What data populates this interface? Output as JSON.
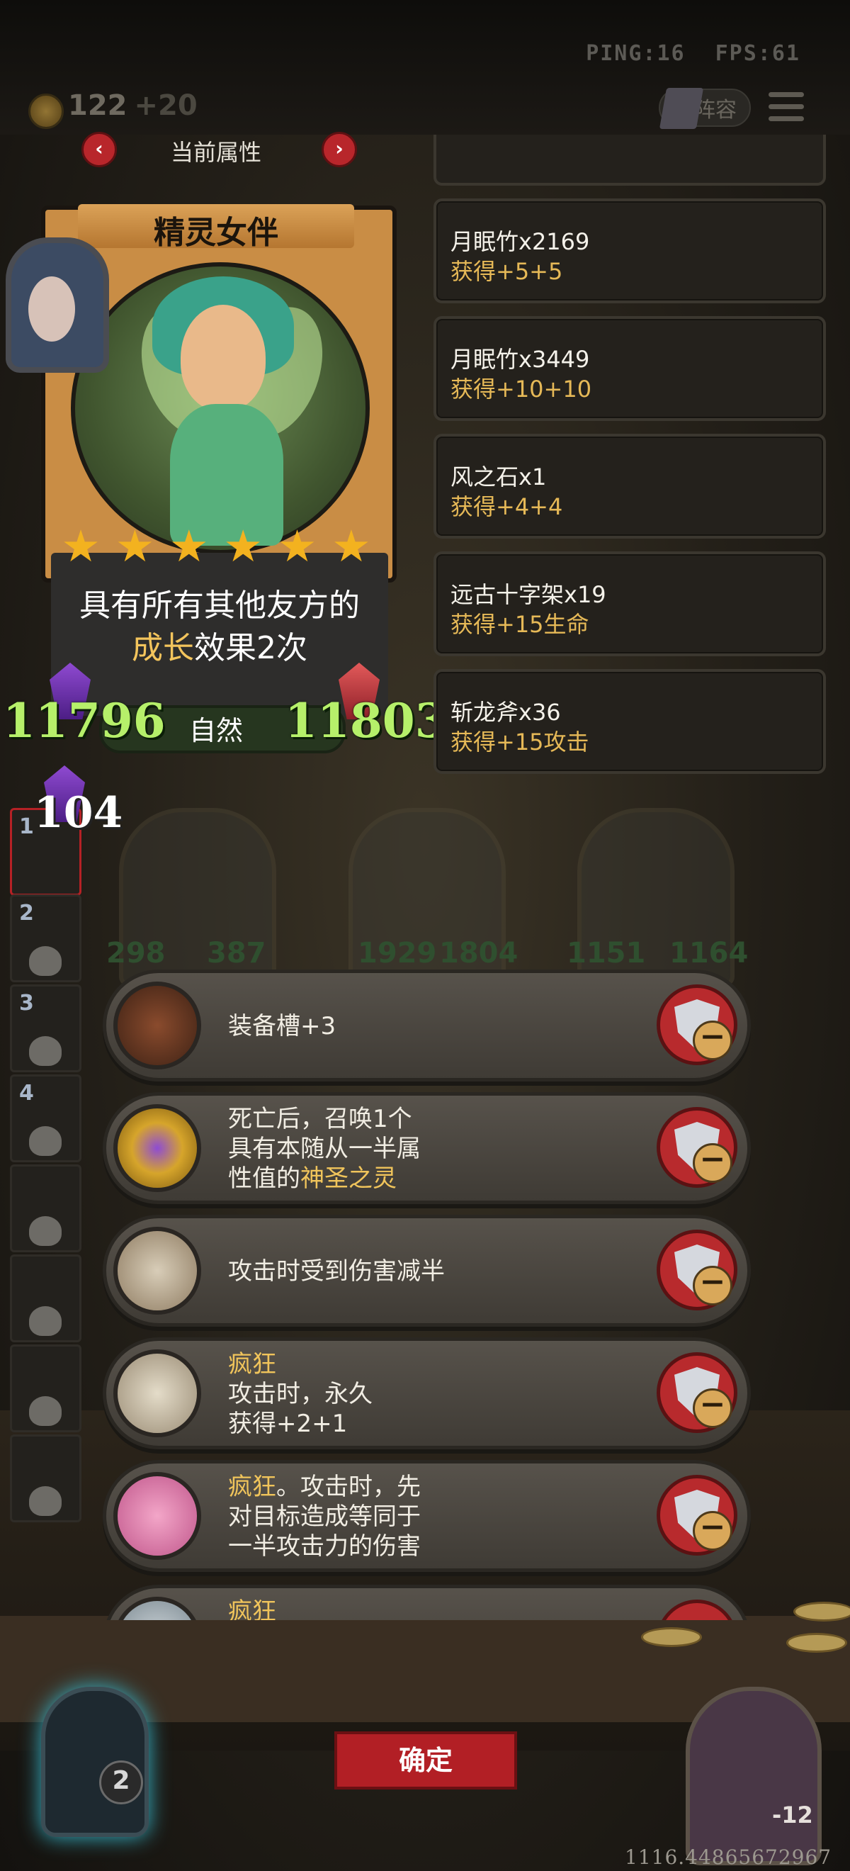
{
  "status_bar": {
    "ping": "PING:16",
    "fps": "FPS:61"
  },
  "top_bar": {
    "gold": "122",
    "gold_income": "+20",
    "lineup_label": "阵容"
  },
  "attribute_panel": {
    "title": "当前属性",
    "prev_icon": "chevron-left-icon",
    "next_icon": "chevron-right-icon"
  },
  "hero": {
    "name": "精灵女伴",
    "stars": 6,
    "description_line1": "具有所有其他友方的",
    "description_highlight": "成长",
    "description_line2_rest": "效果2次",
    "attack": "11796",
    "health": "11803",
    "element": "自然",
    "count": "104"
  },
  "materials": [
    {
      "name": "月眠竹x2169",
      "gain": "获得+5+5"
    },
    {
      "name": "月眠竹x3449",
      "gain": "获得+10+10"
    },
    {
      "name": "风之石x1",
      "gain": "获得+4+4"
    },
    {
      "name": "远古十字架x19",
      "gain": "获得+15生命"
    },
    {
      "name": "斩龙斧x36",
      "gain": "获得+15攻击"
    }
  ],
  "equipment": [
    {
      "icon": "backpack-icon",
      "lines": [
        "装备槽+3"
      ]
    },
    {
      "icon": "gold-ring-icon",
      "lines": [
        "死亡后，召唤1个",
        "具有本随从一半属"
      ],
      "line3_prefix": "性值的",
      "line3_highlight": "神圣之灵"
    },
    {
      "icon": "crossbow-icon",
      "lines": [
        "攻击时受到伤害减半"
      ]
    },
    {
      "icon": "crossed-swords-icon",
      "highlight": "疯狂",
      "lines": [
        "攻击时，永久",
        "获得+2+1"
      ]
    },
    {
      "icon": "pink-hammer-icon",
      "highlight": "疯狂",
      "line1_rest": "。攻击时，先",
      "lines": [
        "对目标造成等同于",
        "一半攻击力的伤害"
      ]
    },
    {
      "icon": "axe-icon",
      "highlight": "疯狂"
    }
  ],
  "slots": [
    "1",
    "2",
    "3",
    "4"
  ],
  "bg_cards": [
    {
      "atk": "298",
      "hp": "387"
    },
    {
      "atk": "1929",
      "hp": "1804"
    },
    {
      "atk": "1151",
      "hp": "1164"
    }
  ],
  "confirm_label": "确定",
  "player": {
    "count": "2"
  },
  "opponent": {
    "hp": "-12"
  },
  "coordinate": "1116.44865672967",
  "colors": {
    "accent_red": "#b21f25",
    "stat_green": "#b6f06a",
    "highlight_gold": "#f0c45b"
  }
}
